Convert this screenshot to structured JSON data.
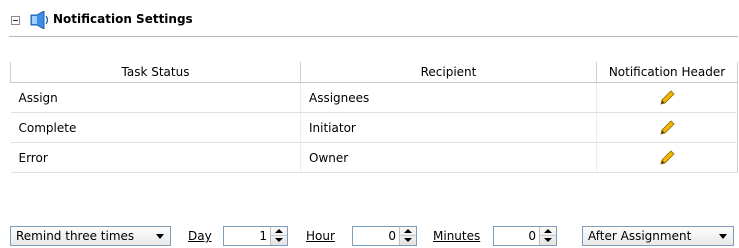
{
  "section": {
    "title": "Notification Settings",
    "icon": "bell-icon",
    "collapse_icon": "collapse-icon"
  },
  "table": {
    "columns": [
      "Task Status",
      "Recipient",
      "Notification Header"
    ],
    "rows": [
      {
        "status": "Assign",
        "recipient": "Assignees",
        "action_icon": "pencil-icon"
      },
      {
        "status": "Complete",
        "recipient": "Initiator",
        "action_icon": "pencil-icon"
      },
      {
        "status": "Error",
        "recipient": "Owner",
        "action_icon": "pencil-icon"
      }
    ]
  },
  "reminder": {
    "frequency": "Remind three times",
    "day_label": "Day",
    "day_value": "1",
    "hour_label": "Hour",
    "hour_value": "0",
    "minutes_label": "Minutes",
    "minutes_value": "0",
    "relative_to": "After Assignment"
  },
  "colors": {
    "pencil": "#e0a800",
    "bell": "#2a7fd4",
    "border": "#7f9db9"
  }
}
